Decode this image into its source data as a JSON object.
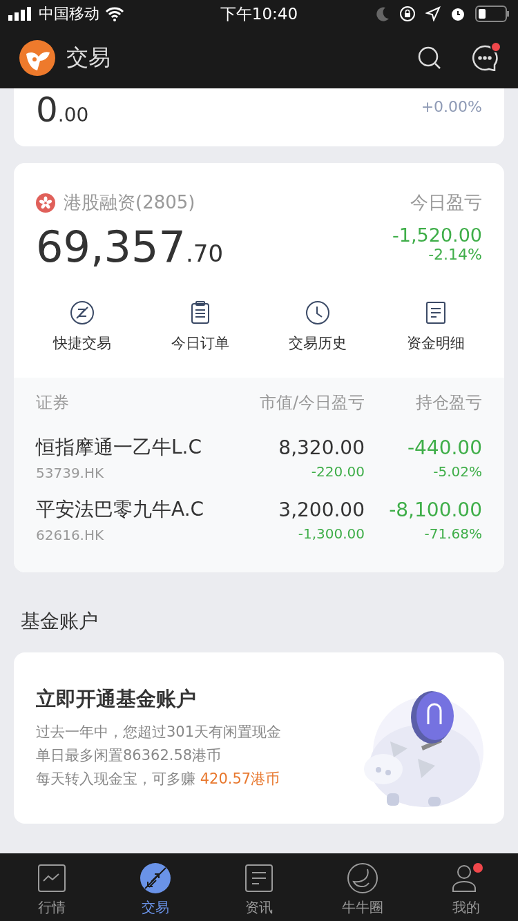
{
  "status_bar": {
    "carrier": "中国移动",
    "time": "下午10:40"
  },
  "header": {
    "title": "交易",
    "message_badge": true
  },
  "top_card": {
    "amount_int": "0",
    "amount_dec": ".00",
    "change_pct": "+0.00%"
  },
  "margin_account": {
    "name": "港股融资(2805)",
    "amount_int": "69,357",
    "amount_dec": ".70",
    "pnl_label": "今日盈亏",
    "pnl": "-1,520.00",
    "pnl_pct": "-2.14%",
    "actions": [
      {
        "kind": "quick",
        "label": "快捷交易"
      },
      {
        "kind": "orders",
        "label": "今日订单"
      },
      {
        "kind": "history",
        "label": "交易历史"
      },
      {
        "kind": "funds",
        "label": "资金明细"
      }
    ],
    "columns": [
      "证券",
      "市值/今日盈亏",
      "持仓盈亏"
    ],
    "holdings": [
      {
        "name": "恒指摩通一乙牛L.C",
        "code": "53739.HK",
        "market_value": "8,320.00",
        "day_pnl": "-220.00",
        "pnl": "-440.00",
        "pnl_pct": "-5.02%"
      },
      {
        "name": "平安法巴零九牛A.C",
        "code": "62616.HK",
        "market_value": "3,200.00",
        "day_pnl": "-1,300.00",
        "pnl": "-8,100.00",
        "pnl_pct": "-71.68%"
      }
    ]
  },
  "fund_section": {
    "title": "基金账户",
    "card_title": "立即开通基金账户",
    "lines": [
      "过去一年中，您超过301天有闲置现金",
      "单日最多闲置86362.58港币"
    ],
    "promo_prefix": "每天转入现金宝，可多赚 ",
    "promo_highlight": "420.57港币"
  },
  "tabs": [
    {
      "kind": "market",
      "label": "行情",
      "selected": false,
      "badge": false
    },
    {
      "kind": "trade",
      "label": "交易",
      "selected": true,
      "badge": false
    },
    {
      "kind": "news",
      "label": "资讯",
      "selected": false,
      "badge": false
    },
    {
      "kind": "community",
      "label": "牛牛圈",
      "selected": false,
      "badge": false
    },
    {
      "kind": "me",
      "label": "我的",
      "selected": false,
      "badge": true
    }
  ]
}
